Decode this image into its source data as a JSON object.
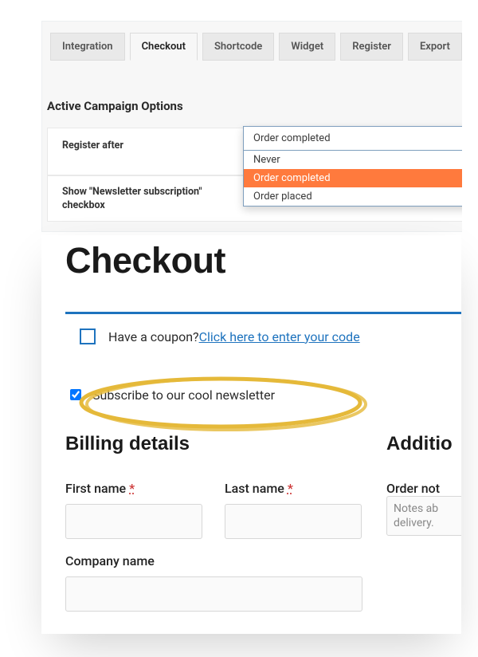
{
  "admin": {
    "tabs": {
      "t0": "Integration",
      "t1": "Checkout",
      "t2": "Shortcode",
      "t3": "Widget",
      "t4": "Register",
      "t5": "Export"
    },
    "section_title": "Active Campaign Options",
    "rows": {
      "register_after": "Register after",
      "show_checkbox": "Show \"Newsletter subscription\" checkbox"
    },
    "select": {
      "current": "Order completed",
      "options": {
        "never": "Never",
        "completed": "Order completed",
        "placed": "Order placed"
      }
    }
  },
  "checkout": {
    "title": "Checkout",
    "coupon": {
      "prompt": "Have a coupon? ",
      "link": "Click here to enter your code"
    },
    "newsletter_label": "Subscribe to our cool newsletter",
    "billing_heading": "Billing details",
    "additional_heading": "Additio",
    "fields": {
      "first_name": "First name",
      "last_name": "Last name",
      "company": "Company name",
      "order_notes_label": "Order not",
      "notes_line1": "Notes ab",
      "notes_line2": "delivery."
    },
    "required_marker": "*"
  }
}
